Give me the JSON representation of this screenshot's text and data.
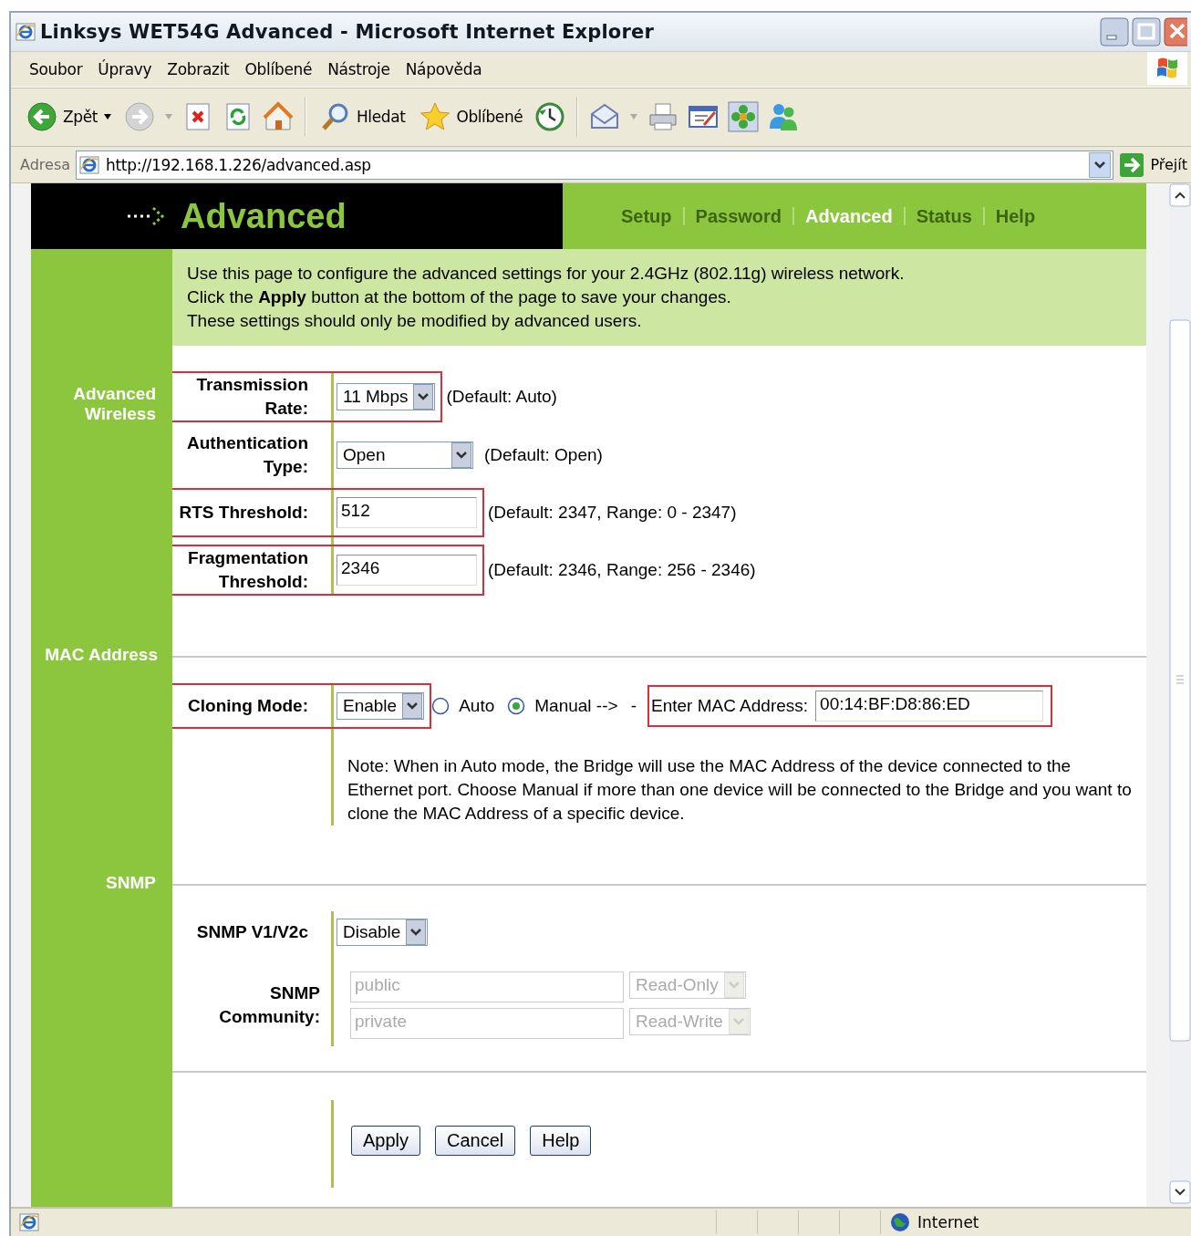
{
  "window": {
    "title": "Linksys WET54G Advanced - Microsoft Internet Explorer"
  },
  "menu": [
    "Soubor",
    "Úpravy",
    "Zobrazit",
    "Oblíbené",
    "Nástroje",
    "Nápověda"
  ],
  "toolbar": [
    {
      "kind": "back",
      "label": "Zpět"
    },
    {
      "kind": "forward"
    },
    {
      "kind": "stop"
    },
    {
      "kind": "refresh"
    },
    {
      "kind": "home"
    },
    {
      "kind": "search",
      "label": "Hledat"
    },
    {
      "kind": "favorites",
      "label": "Oblíbené"
    },
    {
      "kind": "history"
    },
    {
      "kind": "mail"
    },
    {
      "kind": "print"
    },
    {
      "kind": "edit"
    },
    {
      "kind": "flower"
    },
    {
      "kind": "messenger"
    }
  ],
  "address": {
    "label": "Adresa",
    "value": "http://192.168.1.226/advanced.asp",
    "go": "Přejít"
  },
  "page": {
    "title": "Advanced",
    "tabs": [
      {
        "label": "Setup",
        "selected": false
      },
      {
        "label": "Password",
        "selected": false
      },
      {
        "label": "Advanced",
        "selected": true
      },
      {
        "label": "Status",
        "selected": false
      },
      {
        "label": "Help",
        "selected": false
      }
    ],
    "intro": [
      "Use this page to configure the advanced settings for your 2.4GHz (802.11g) wireless network.",
      "Click the **Apply** button at the bottom of the page to save your changes.",
      "These settings should only be modified by advanced users."
    ],
    "sections": [
      {
        "title": "Advanced Wireless",
        "rows": [
          {
            "kind": "select",
            "label": "Transmission Rate:",
            "value": "11 Mbps",
            "hint": "(Default: Auto)",
            "highlighted": true
          },
          {
            "kind": "select",
            "label": "Authentication Type:",
            "value": "Open",
            "hint": "(Default: Open)",
            "highlighted": false
          },
          {
            "kind": "text",
            "label": "RTS Threshold:",
            "value": "512",
            "hint": "(Default: 2347, Range: 0 - 2347)",
            "highlighted": true
          },
          {
            "kind": "text",
            "label": "Fragmentation Threshold:",
            "value": "2346",
            "hint": "(Default: 2346, Range: 256 - 2346)",
            "highlighted": true
          }
        ]
      },
      {
        "title": "MAC Address",
        "rows": [
          {
            "kind": "clone",
            "label": "Cloning Mode:",
            "value": "Enable",
            "highlighted": true,
            "radios": [
              {
                "label": "Auto",
                "selected": false
              },
              {
                "label": "Manual -->",
                "selected": true
              }
            ],
            "separator": "-",
            "mac_label": "Enter MAC Address:",
            "mac_value": "00:14:BF:D8:86:ED",
            "mac_highlighted": true
          },
          {
            "kind": "note",
            "text": "Note: When in Auto mode, the Bridge will use the MAC Address of the device connected to the Ethernet port. Choose Manual if more than one device will be connected to the Bridge and you want to clone the MAC Address of a specific device."
          }
        ]
      },
      {
        "title": "SNMP",
        "rows": [
          {
            "kind": "select",
            "label": "SNMP V1/V2c",
            "value": "Disable",
            "highlighted": false
          },
          {
            "kind": "community",
            "label": "SNMP Community:",
            "disabled": true,
            "entries": [
              {
                "value": "public",
                "access": "Read-Only"
              },
              {
                "value": "private",
                "access": "Read-Write"
              }
            ]
          }
        ]
      }
    ],
    "buttons": [
      "Apply",
      "Cancel",
      "Help"
    ]
  },
  "status_bar": {
    "zone": "Internet"
  }
}
